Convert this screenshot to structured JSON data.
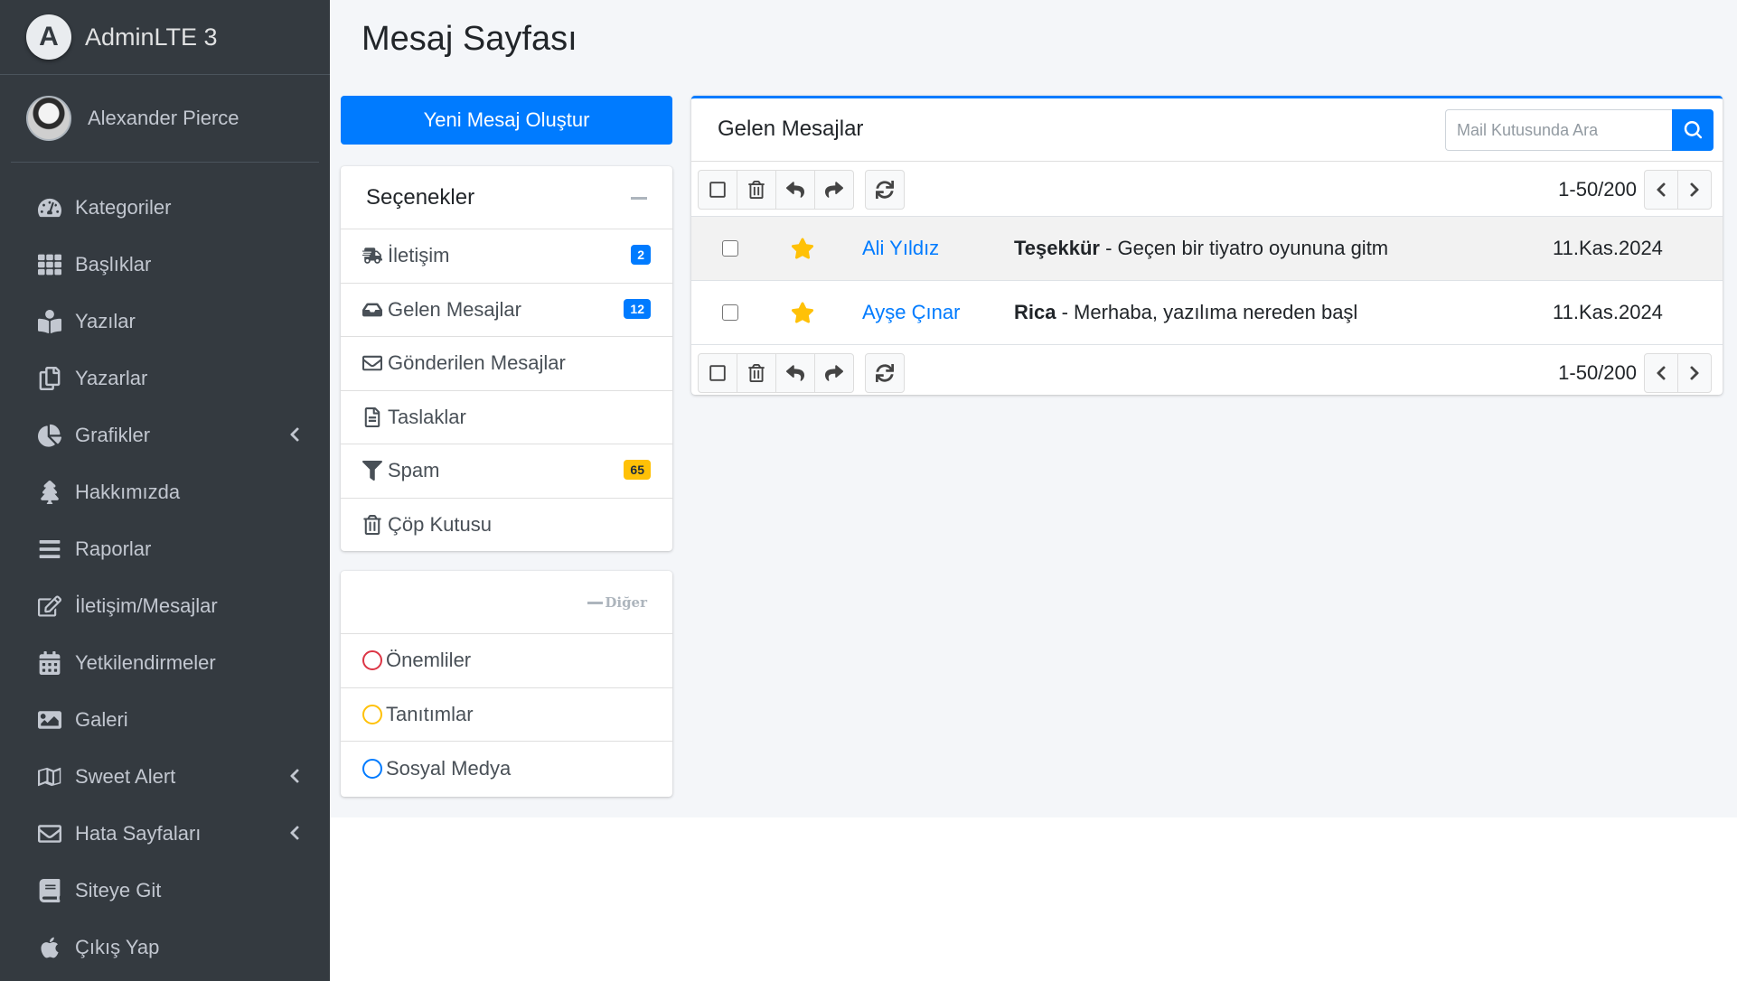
{
  "brand": {
    "name": "AdminLTE 3",
    "logo_letter": "A"
  },
  "user": {
    "name": "Alexander Pierce"
  },
  "sidebar": {
    "items": [
      {
        "label": "Kategoriler",
        "icon": "tachometer-icon",
        "has_chevron": false
      },
      {
        "label": "Başlıklar",
        "icon": "grid-icon",
        "has_chevron": false
      },
      {
        "label": "Yazılar",
        "icon": "reader-icon",
        "has_chevron": false
      },
      {
        "label": "Yazarlar",
        "icon": "copy-icon",
        "has_chevron": false
      },
      {
        "label": "Grafikler",
        "icon": "pie-chart-icon",
        "has_chevron": true
      },
      {
        "label": "Hakkımızda",
        "icon": "tree-icon",
        "has_chevron": false
      },
      {
        "label": "Raporlar",
        "icon": "bars-icon",
        "has_chevron": false
      },
      {
        "label": "İletişim/Mesajlar",
        "icon": "edit-icon",
        "has_chevron": false
      },
      {
        "label": "Yetkilendirmeler",
        "icon": "calendar-icon",
        "has_chevron": false
      },
      {
        "label": "Galeri",
        "icon": "image-icon",
        "has_chevron": false
      },
      {
        "label": "Sweet Alert",
        "icon": "map-icon",
        "has_chevron": true
      },
      {
        "label": "Hata Sayfaları",
        "icon": "envelope-icon",
        "has_chevron": true
      },
      {
        "label": "Siteye Git",
        "icon": "book-icon",
        "has_chevron": false
      },
      {
        "label": "Çıkış Yap",
        "icon": "apple-icon",
        "has_chevron": false
      }
    ]
  },
  "page": {
    "title": "Mesaj Sayfası"
  },
  "compose": {
    "label": "Yeni Mesaj Oluştur"
  },
  "options": {
    "title": "Seçenekler",
    "folders": [
      {
        "label": "İletişim",
        "icon": "truck-icon",
        "badge": "2",
        "badge_style": "primary"
      },
      {
        "label": "Gelen Mesajlar",
        "icon": "inbox-icon",
        "badge": "12",
        "badge_style": "primary"
      },
      {
        "label": "Gönderilen Mesajlar",
        "icon": "envelope-icon",
        "badge": "",
        "badge_style": ""
      },
      {
        "label": "Taslaklar",
        "icon": "file-icon",
        "badge": "",
        "badge_style": ""
      },
      {
        "label": "Spam",
        "icon": "filter-icon",
        "badge": "65",
        "badge_style": "warning"
      },
      {
        "label": "Çöp Kutusu",
        "icon": "trash-icon",
        "badge": "",
        "badge_style": ""
      }
    ]
  },
  "other": {
    "title": "Diğer",
    "labels": [
      {
        "label": "Önemliler",
        "color": "#dc3545"
      },
      {
        "label": "Tanıtımlar",
        "color": "#ffc107"
      },
      {
        "label": "Sosyal Medya",
        "color": "#007bff"
      }
    ]
  },
  "mailbox": {
    "title": "Gelen Mesajlar",
    "search_placeholder": "Mail Kutusunda Ara",
    "pager_text": "1-50/200",
    "messages": [
      {
        "sender": "Ali Yıldız",
        "subject": "Teşekkür",
        "preview": " - Geçen bir tiyatro oyununa gitm",
        "date": "11.Kas.2024",
        "starred": true
      },
      {
        "sender": "Ayşe Çınar",
        "subject": "Rica",
        "preview": " - Merhaba, yazılıma nereden başl",
        "date": "11.Kas.2024",
        "starred": true
      }
    ]
  },
  "colors": {
    "sidebar_bg": "#343a40",
    "accent": "#007bff",
    "warning": "#ffc107",
    "danger": "#dc3545",
    "content_bg": "#f4f6f9"
  }
}
